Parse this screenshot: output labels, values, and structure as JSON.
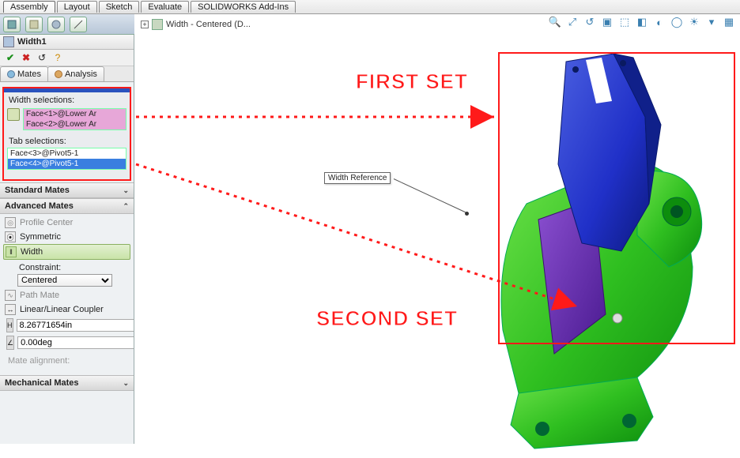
{
  "menubar": {
    "tabs": [
      "Assembly",
      "Layout",
      "Sketch",
      "Evaluate",
      "SOLIDWORKS Add-Ins"
    ],
    "active": 0
  },
  "feature": {
    "name": "Width1"
  },
  "sub_tabs": {
    "mates": "Mates",
    "analysis": "Analysis"
  },
  "selections": {
    "width_label": "Width selections:",
    "width_items": [
      "Face<1>@Lower Ar",
      "Face<2>@Lower Ar"
    ],
    "tab_label": "Tab selections:",
    "tab_items": [
      "Face<3>@Pivot5-1",
      "Face<4>@Pivot5-1"
    ]
  },
  "sections": {
    "standard": "Standard Mates",
    "advanced": "Advanced Mates",
    "mechanical": "Mechanical Mates"
  },
  "advanced_mates": {
    "profile_center": "Profile Center",
    "symmetric": "Symmetric",
    "width": "Width",
    "constraint_label": "Constraint:",
    "constraint_value": "Centered",
    "path_mate": "Path Mate",
    "linear_coupler": "Linear/Linear Coupler",
    "distance_value": "8.26771654in",
    "angle_value": "0.00deg",
    "mate_alignment": "Mate alignment:"
  },
  "viewport": {
    "tree_label": "Width - Centered  (D...",
    "callout": "Width Reference"
  },
  "annotations": {
    "first": "FIRST SET",
    "second": "SECOND SET"
  },
  "icons": {
    "ok": "ok-icon",
    "cancel": "cancel-icon",
    "undo": "undo-icon",
    "help": "help-icon"
  }
}
